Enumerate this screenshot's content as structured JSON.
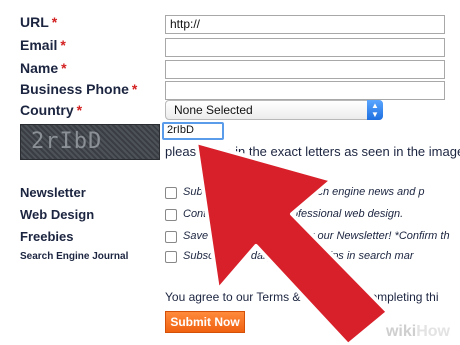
{
  "form": {
    "labels": {
      "url": "URL",
      "email": "Email",
      "name": "Name",
      "business_phone": "Business Phone",
      "country": "Country",
      "newsletter": "Newsletter",
      "web_design": "Web Design",
      "freebies": "Freebies",
      "search_engine_journal": "Search Engine Journal"
    },
    "required_mark": "*",
    "url_value": "http://",
    "country_selected": "None Selected",
    "captcha_text": "2rIbD",
    "captcha_input_value": "2rIbD",
    "captcha_hint": "please type in the exact letters as seen in the image",
    "checkbox_texts": {
      "newsletter": "Submit your site to our search engine news and p",
      "web_design": "Contact me about a professional web design.",
      "freebies": "Save Money — Sign up for our Newsletter! *Confirm th",
      "search_engine_journal": "Subscribe for daily news and tips in search mar"
    },
    "agree_text": "You agree to our Terms & Policies by completing thi",
    "submit_label": "Submit Now"
  },
  "watermark": {
    "wiki": "wiki",
    "how": "How"
  },
  "colors": {
    "required": "#d32020",
    "arrow": "#d8202a",
    "submit": "#f06210",
    "select_arrow": "#1f6fe0"
  }
}
